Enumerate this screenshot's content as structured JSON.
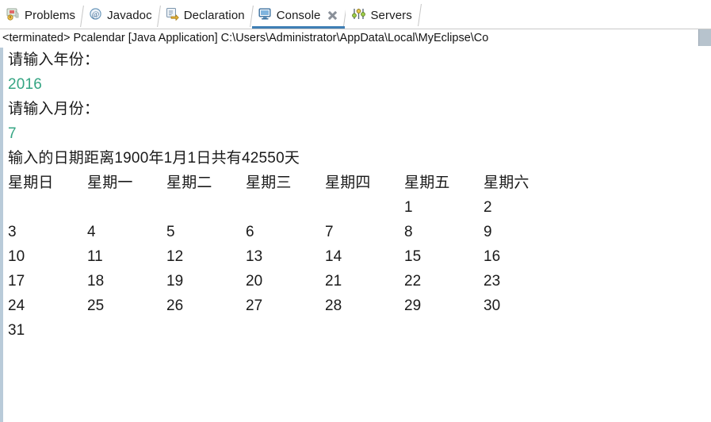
{
  "tabs": [
    {
      "id": "problems",
      "label": "Problems",
      "icon": "problems-icon",
      "active": false,
      "closeable": false
    },
    {
      "id": "javadoc",
      "label": "Javadoc",
      "icon": "javadoc-at-icon",
      "active": false,
      "closeable": false
    },
    {
      "id": "declaration",
      "label": "Declaration",
      "icon": "declaration-icon",
      "active": false,
      "closeable": false
    },
    {
      "id": "console",
      "label": "Console",
      "icon": "console-icon",
      "active": true,
      "closeable": true
    },
    {
      "id": "servers",
      "label": "Servers",
      "icon": "servers-icon",
      "active": false,
      "closeable": false
    }
  ],
  "status": {
    "text": "<terminated> Pcalendar [Java Application] C:\\Users\\Administrator\\AppData\\Local\\MyEclipse\\Co"
  },
  "console": {
    "lines": [
      {
        "text": "请输入年份：",
        "kind": "output"
      },
      {
        "text": "2016",
        "kind": "input"
      },
      {
        "text": "请输入月份：",
        "kind": "output"
      },
      {
        "text": "7",
        "kind": "input"
      }
    ],
    "summary": "输入的日期距离1900年1月1日共有42550天",
    "calendar": {
      "headers": [
        "星期日",
        "星期一",
        "星期二",
        "星期三",
        "星期四",
        "星期五",
        "星期六"
      ],
      "rows": [
        [
          "",
          "",
          "",
          "",
          "",
          "1",
          "2"
        ],
        [
          "3",
          "4",
          "5",
          "6",
          "7",
          "8",
          "9"
        ],
        [
          "10",
          "11",
          "12",
          "13",
          "14",
          "15",
          "16"
        ],
        [
          "17",
          "18",
          "19",
          "20",
          "21",
          "22",
          "23"
        ],
        [
          "24",
          "25",
          "26",
          "27",
          "28",
          "29",
          "30"
        ],
        [
          "31",
          "",
          "",
          "",
          "",
          "",
          ""
        ]
      ]
    }
  },
  "colors": {
    "input_echo": "#35a583",
    "active_tab_underline": "#3f7fb5",
    "console_left_border": "#b9cbd9"
  }
}
